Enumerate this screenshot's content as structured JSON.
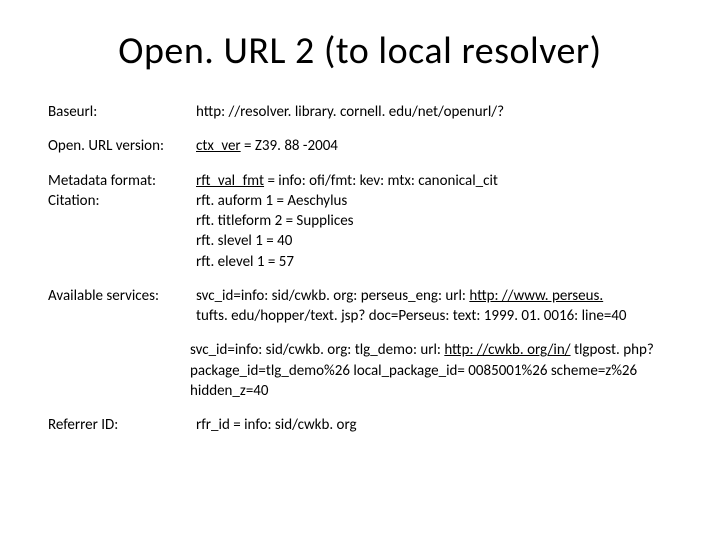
{
  "title": "Open. URL 2 (to local resolver)",
  "rows": {
    "baseurl": {
      "label": "Baseurl:",
      "value": "http: //resolver. library. cornell. edu/net/openurl/?"
    },
    "version": {
      "label": "Open. URL version:",
      "value_plain": "ctx_ver",
      "value_eq": " = Z39. 88 -2004"
    },
    "metadata": {
      "label1": "Metadata format:",
      "label2": "Citation:",
      "l1a": "rft_val_fmt",
      "l1b": " = info: ofi/fmt: kev: mtx: canonical_cit",
      "l2": "rft. auform 1 = Aeschylus",
      "l3": "rft. titleform 2 = Supplices",
      "l4": "rft. slevel 1 = 40",
      "l5": "rft. elevel 1 = 57"
    },
    "services": {
      "label": "Available services:",
      "s1a": "svc_id=info: sid/cwkb. org: perseus_eng: url: ",
      "s1b": "http: //www. perseus.",
      "s1c": "tufts. edu/hopper/text. jsp? doc=Perseus: text: 1999. 01. 0016: line=40",
      "s2a": "svc_id=info: sid/cwkb. org: tlg_demo: url: ",
      "s2b": "http: //cwkb. org/in/",
      "s2c": "tlgpost. php? package_id=tlg_demo%26 local_package_id=",
      "s2d": "0085001%26 scheme=z%26 hidden_z=40"
    },
    "referrer": {
      "label": "Referrer ID:",
      "value": "rfr_id = info: sid/cwkb. org"
    }
  }
}
